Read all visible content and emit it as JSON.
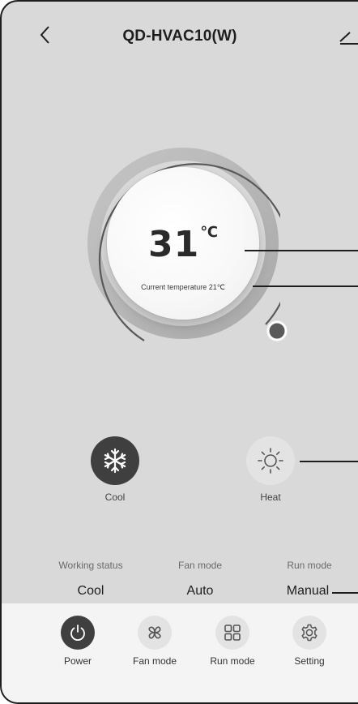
{
  "header": {
    "title": "QD-HVAC10(W)",
    "back_icon": "chevron-left-icon",
    "edit_icon": "edit-icon"
  },
  "thermostat": {
    "set_temperature": "31",
    "unit": "℃",
    "current_temperature_text": "Current temperature 21℃"
  },
  "modes": [
    {
      "label": "Cool",
      "icon": "snowflake-icon",
      "active": true
    },
    {
      "label": "Heat",
      "icon": "sun-icon",
      "active": false
    }
  ],
  "status": [
    {
      "label": "Working status",
      "value": "Cool"
    },
    {
      "label": "Fan mode",
      "value": "Auto"
    },
    {
      "label": "Run mode",
      "value": "Manual"
    }
  ],
  "tabs": [
    {
      "label": "Power",
      "icon": "power-icon"
    },
    {
      "label": "Fan mode",
      "icon": "fan-icon"
    },
    {
      "label": "Run mode",
      "icon": "grid-icon"
    },
    {
      "label": "Setting",
      "icon": "gear-icon"
    }
  ],
  "colors": {
    "background": "#d9d9d9",
    "bottom_bar": "#f4f4f4",
    "active_button": "#3f3f3f",
    "inactive_button": "#e3e3e3",
    "text": "#1e1e1e"
  }
}
